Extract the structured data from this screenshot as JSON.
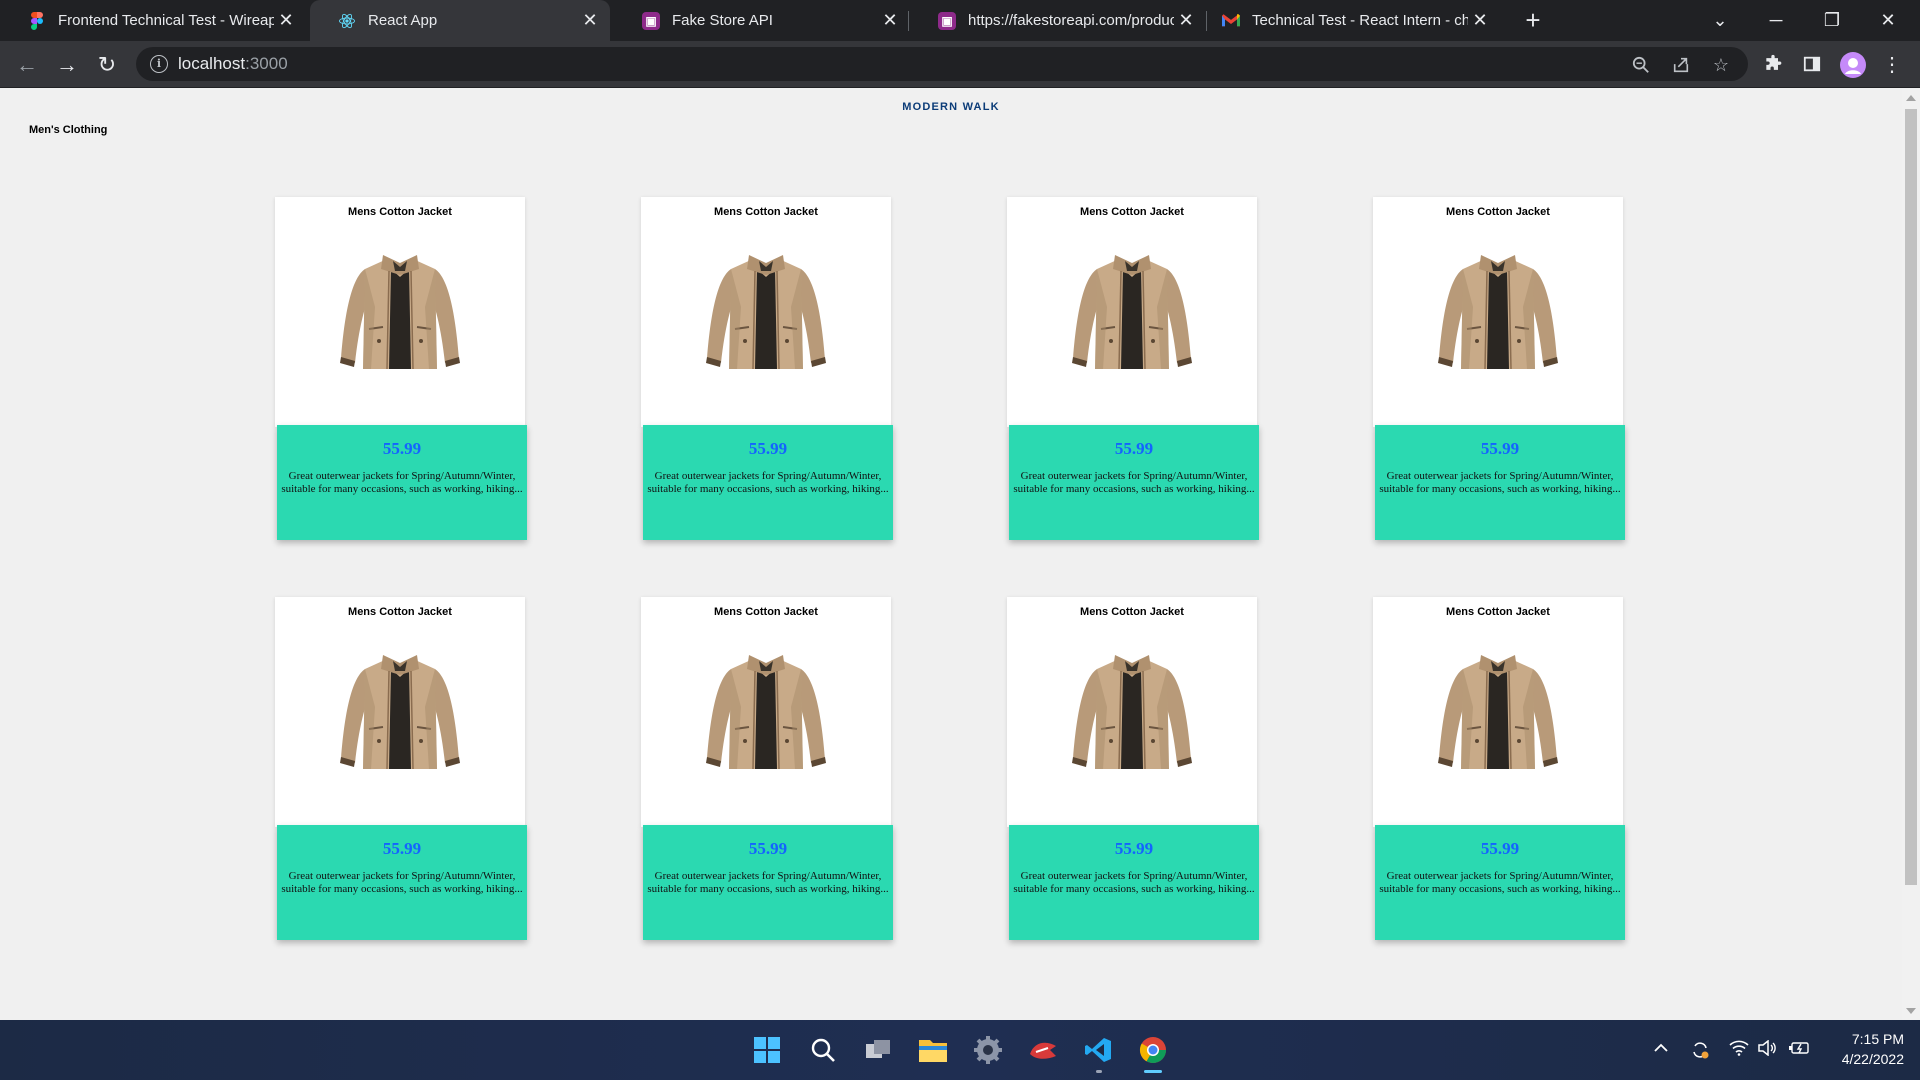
{
  "browser": {
    "tabs": [
      {
        "title": "Frontend Technical Test - Wireap",
        "icon": "figma-icon"
      },
      {
        "title": "React App",
        "icon": "react-icon",
        "active": true
      },
      {
        "title": "Fake Store API",
        "icon": "fakestore-icon"
      },
      {
        "title": "https://fakestoreapi.com/product",
        "icon": "fakestore-icon"
      },
      {
        "title": "Technical Test - React Intern - cha",
        "icon": "gmail-icon"
      }
    ],
    "address": {
      "host": "localhost",
      "port": ":3000"
    }
  },
  "page": {
    "brand": "MODERN WALK",
    "category": "Men's Clothing",
    "products": [
      {
        "title": "Mens Cotton Jacket",
        "price": "55.99",
        "description": "Great outerwear jackets for Spring/Autumn/Winter, suitable for many occasions, such as working, hiking..."
      },
      {
        "title": "Mens Cotton Jacket",
        "price": "55.99",
        "description": "Great outerwear jackets for Spring/Autumn/Winter, suitable for many occasions, such as working, hiking..."
      },
      {
        "title": "Mens Cotton Jacket",
        "price": "55.99",
        "description": "Great outerwear jackets for Spring/Autumn/Winter, suitable for many occasions, such as working, hiking..."
      },
      {
        "title": "Mens Cotton Jacket",
        "price": "55.99",
        "description": "Great outerwear jackets for Spring/Autumn/Winter, suitable for many occasions, such as working, hiking..."
      },
      {
        "title": "Mens Cotton Jacket",
        "price": "55.99",
        "description": "Great outerwear jackets for Spring/Autumn/Winter, suitable for many occasions, such as working, hiking..."
      },
      {
        "title": "Mens Cotton Jacket",
        "price": "55.99",
        "description": "Great outerwear jackets for Spring/Autumn/Winter, suitable for many occasions, such as working, hiking..."
      },
      {
        "title": "Mens Cotton Jacket",
        "price": "55.99",
        "description": "Great outerwear jackets for Spring/Autumn/Winter, suitable for many occasions, such as working, hiking..."
      },
      {
        "title": "Mens Cotton Jacket",
        "price": "55.99",
        "description": "Great outerwear jackets for Spring/Autumn/Winter, suitable for many occasions, such as working, hiking..."
      }
    ]
  },
  "taskbar": {
    "time": "7:15 PM",
    "date": "4/22/2022"
  },
  "colors": {
    "card_bottom": "#2bd9b1",
    "price": "#1463ff",
    "brand": "#0c3c78"
  }
}
